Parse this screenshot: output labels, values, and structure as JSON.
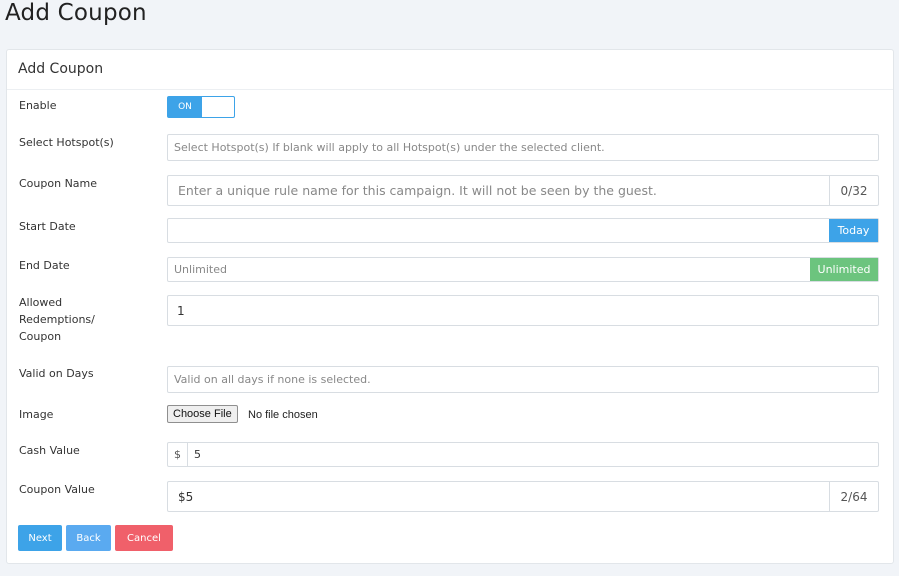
{
  "page_title": "Add Coupon",
  "panel_title": "Add Coupon",
  "labels": {
    "enable": "Enable",
    "hotspots": "Select Hotspot(s)",
    "coupon_name": "Coupon Name",
    "start_date": "Start Date",
    "end_date": "End Date",
    "redemptions": "Allowed Redemptions/ Coupon",
    "valid_days": "Valid on Days",
    "image": "Image",
    "cash_value": "Cash Value",
    "coupon_value": "Coupon Value"
  },
  "toggle": {
    "on_label": "ON"
  },
  "fields": {
    "hotspots_placeholder": "Select Hotspot(s) If blank will apply to all Hotspot(s) under the selected client.",
    "coupon_name_placeholder": "Enter a unique rule name for this campaign. It will not be seen by the guest.",
    "coupon_name_counter": "0/32",
    "start_date_value": "",
    "today_button": "Today",
    "end_date_placeholder": "Unlimited",
    "unlimited_button": "Unlimited",
    "redemptions_value": "1",
    "valid_days_placeholder": "Valid on all days if none is selected.",
    "file_button": "Choose File",
    "file_status": "No file chosen",
    "cash_prefix": "$",
    "cash_value": "5",
    "coupon_value": "$5",
    "coupon_value_counter": "2/64"
  },
  "buttons": {
    "next": "Next",
    "back": "Back",
    "cancel": "Cancel"
  },
  "colors": {
    "primary": "#3da3e8",
    "success": "#6cc47e",
    "secondary": "#5aaaf0",
    "danger": "#f0606a"
  }
}
